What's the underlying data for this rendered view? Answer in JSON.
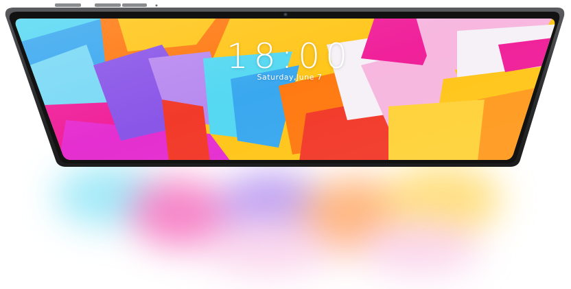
{
  "lockscreen": {
    "time": "18:00",
    "date": "Saturday,June 7"
  },
  "device": {
    "frame_color": "#3a3b3d",
    "bezel_color": "#121212",
    "icons": [
      "camera-icon",
      "volume-button",
      "power-button"
    ]
  },
  "wallpaper": {
    "colors": {
      "pink": "#f0219a",
      "magenta": "#e52fd0",
      "yellow": "#ffc61a",
      "orange": "#ff7a12",
      "red": "#f23a2a",
      "blue": "#3aa8ef",
      "cyan": "#55d8f2",
      "purple": "#8a56e8",
      "light_pink": "#f7b7df",
      "white": "#f5f1f6"
    }
  }
}
